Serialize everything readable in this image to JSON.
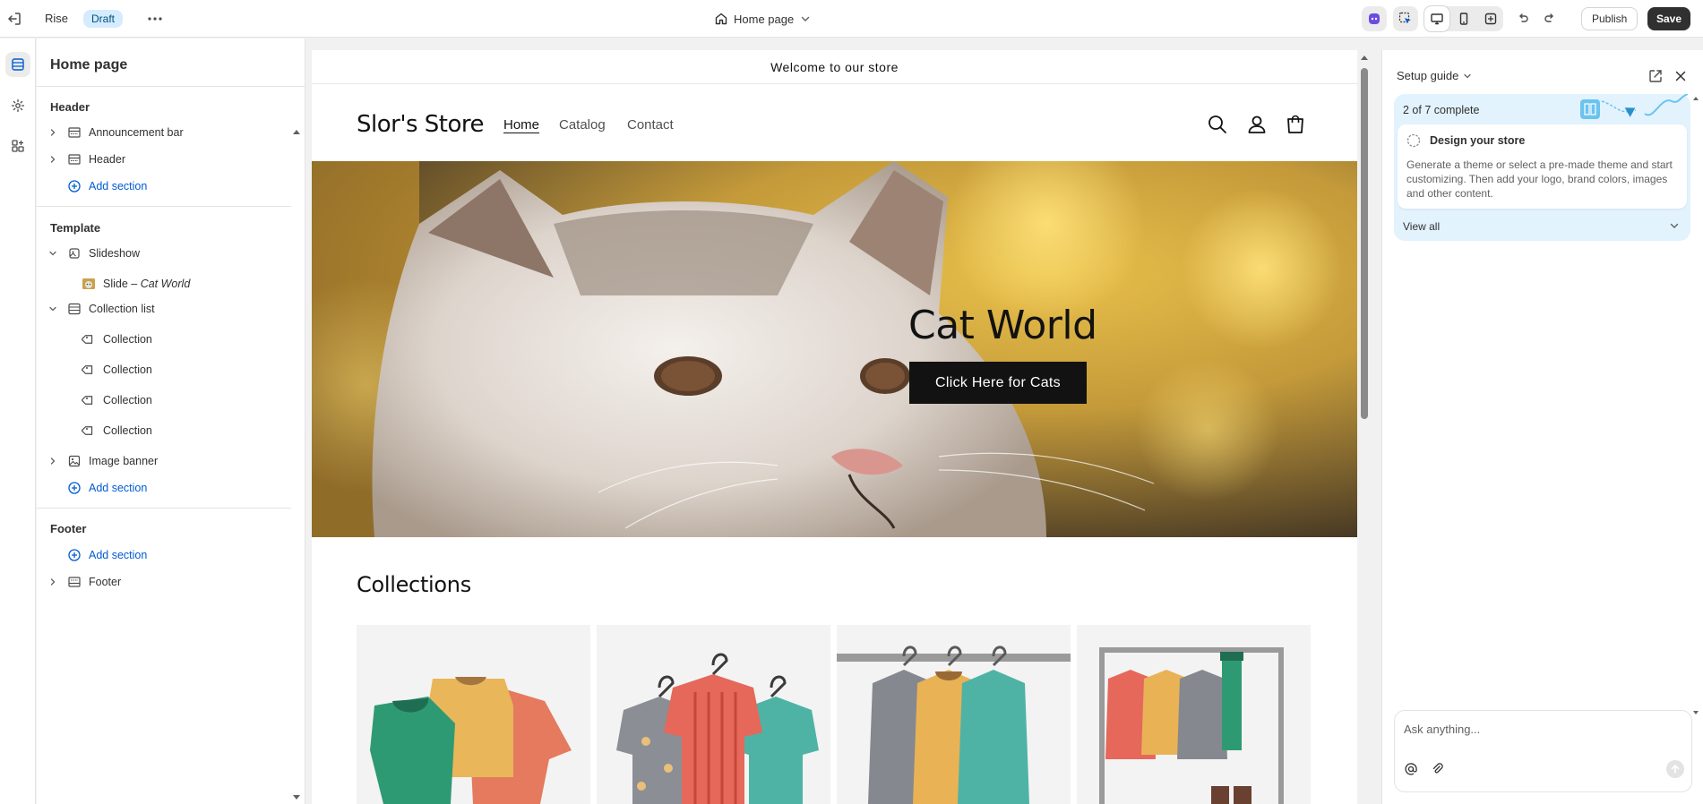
{
  "topbar": {
    "theme_name": "Rise",
    "status_badge": "Draft",
    "page_selector": "Home page",
    "publish_label": "Publish",
    "save_label": "Save",
    "accent": "#303030",
    "badge_color": "#d5ebff"
  },
  "sidebar": {
    "title": "Home page",
    "groups": [
      {
        "heading": "Header",
        "items": [
          "Announcement bar",
          "Header"
        ],
        "add_label": "Add section"
      },
      {
        "heading": "Template",
        "slideshow": "Slideshow",
        "slide_prefix": "Slide – ",
        "slide_name": "Cat World",
        "collection_list": "Collection list",
        "collections": [
          "Collection",
          "Collection",
          "Collection",
          "Collection"
        ],
        "image_banner": "Image banner",
        "add_label": "Add section"
      },
      {
        "heading": "Footer",
        "add_label": "Add section",
        "items": [
          "Footer"
        ]
      }
    ],
    "link_color": "#005bd3"
  },
  "preview": {
    "announcement": "Welcome to our store",
    "store_name": "Slor's Store",
    "nav": [
      "Home",
      "Catalog",
      "Contact"
    ],
    "hero_title": "Cat World",
    "hero_button": "Click Here for Cats",
    "collections_title": "Collections"
  },
  "right_panel": {
    "title": "Setup guide",
    "progress": "2 of 7 complete",
    "progress_done": 2,
    "progress_total": 7,
    "task_title": "Design your store",
    "task_desc": "Generate a theme or select a pre-made theme and start customizing. Then add your logo, brand colors, images and other content.",
    "view_all": "View all",
    "ask_placeholder": "Ask anything..."
  }
}
